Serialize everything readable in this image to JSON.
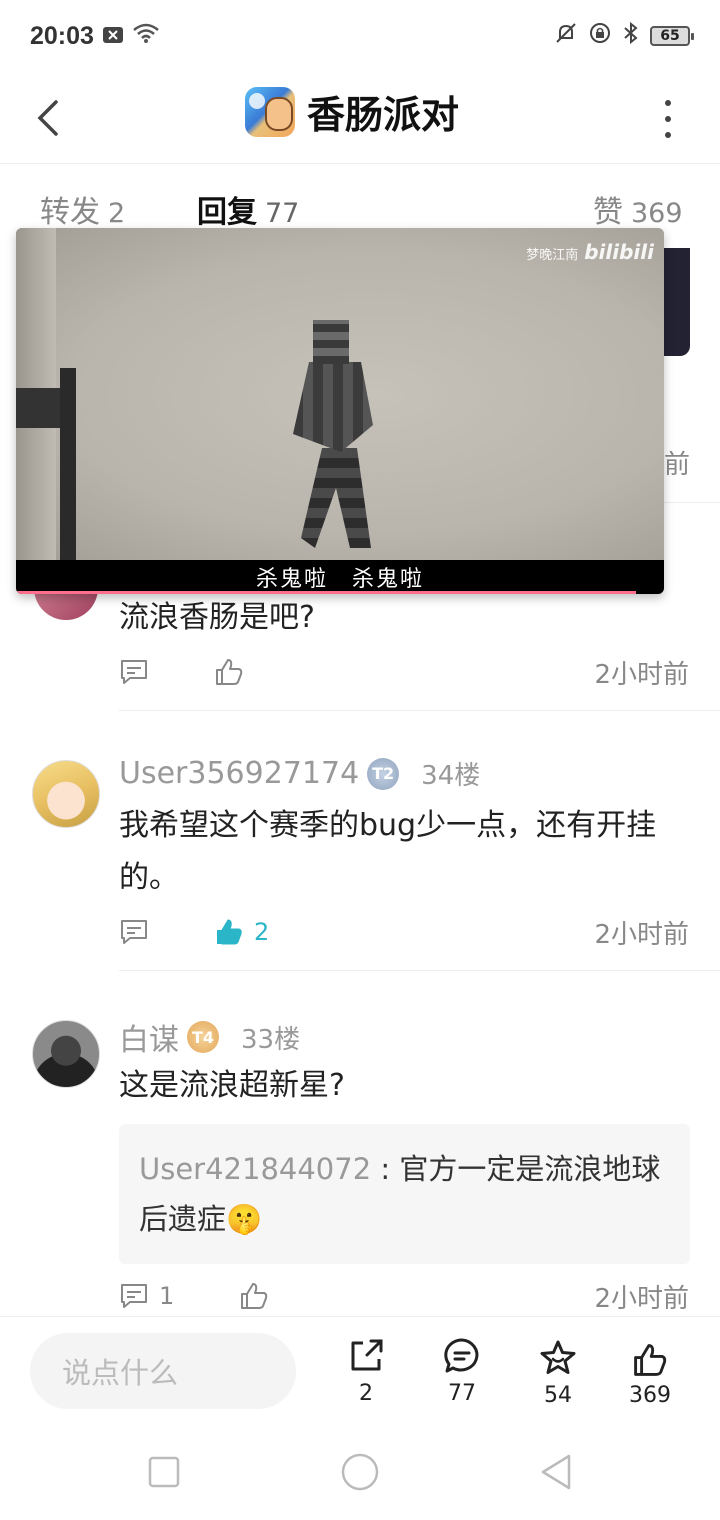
{
  "status": {
    "time": "20:03",
    "battery": "65"
  },
  "header": {
    "title": "香肠派对"
  },
  "tabs": [
    {
      "label": "转发",
      "count": "2"
    },
    {
      "label": "回复",
      "count": "77"
    },
    {
      "label": "赞",
      "count": "369"
    }
  ],
  "video": {
    "watermark_text": "梦晚江南",
    "watermark_brand": "bilibili",
    "subtitle": "杀鬼啦　杀鬼啦"
  },
  "behind": {
    "time_fragment": "前"
  },
  "comments": [
    {
      "text": "流浪香肠是吧?",
      "time": "2小时前"
    },
    {
      "username": "User356927174",
      "level": "T2",
      "floor": "34楼",
      "text": "我希望这个赛季的bug少一点，还有开挂的。",
      "likes": "2",
      "time": "2小时前"
    },
    {
      "username": "白谋",
      "level": "T4",
      "floor": "33楼",
      "text": "这是流浪超新星?",
      "reply_user": "User421844072",
      "reply_sep": " : ",
      "reply_text": "官方一定是流浪地球后遗症🤫",
      "comment_count": "1",
      "time": "2小时前"
    }
  ],
  "bottom": {
    "input_placeholder": "说点什么",
    "share_count": "2",
    "comment_count": "77",
    "fav_count": "54",
    "like_count": "369"
  },
  "colors": {
    "accent": "#2bb5c8",
    "progress": "#ff6f8d"
  }
}
